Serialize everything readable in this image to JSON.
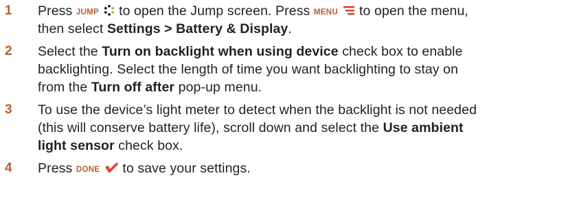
{
  "steps": [
    {
      "number": "1",
      "a": "Press ",
      "key": "JUMP",
      "b": " to open the Jump screen. Press ",
      "key2": "MENU",
      "c": " to open the menu,",
      "d": "then select ",
      "bold": "Settings > Battery & Display",
      "e": "."
    },
    {
      "number": "2",
      "a": "Select the ",
      "bold": "Turn on backlight when using device",
      "b": " check box to enable",
      "line2": "backlighting. Select the length of time you want backlighting to stay on",
      "c": "from the ",
      "bold2": "Turn off after",
      "d": " pop-up menu."
    },
    {
      "number": "3",
      "line1": "To use the device’s light meter to detect when the backlight is not needed",
      "a": "(this will conserve battery life), scroll down and select the ",
      "bold": "Use ambient",
      "bold2": "light sensor",
      "b": " check box."
    },
    {
      "number": "4",
      "a": "Press ",
      "key": "DONE",
      "b": " to save your settings."
    }
  ],
  "icons": {
    "jump": "jump-dots-icon",
    "menu": "menu-lines-icon",
    "done": "done-checkmark-icon"
  },
  "colors": {
    "accent": "#b8602c",
    "text": "#231f20",
    "icon_green": "#8dc63f"
  }
}
